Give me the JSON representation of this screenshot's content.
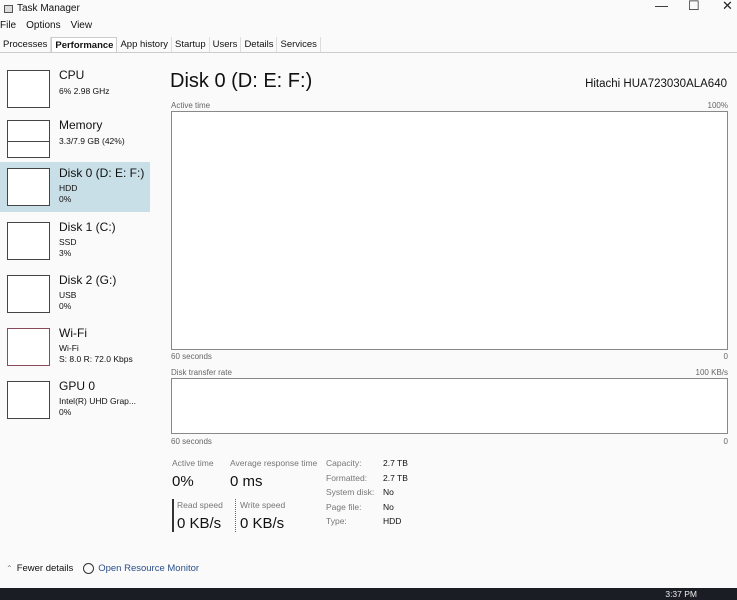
{
  "window": {
    "title": "Task Manager",
    "controls": [
      "—",
      "☐",
      "✕"
    ]
  },
  "menu": [
    "File",
    "Options",
    "View"
  ],
  "tabs": [
    {
      "label": "Processes"
    },
    {
      "label": "Performance",
      "selected": true
    },
    {
      "label": "App history"
    },
    {
      "label": "Startup"
    },
    {
      "label": "Users"
    },
    {
      "label": "Details"
    },
    {
      "label": "Services"
    }
  ],
  "sidebar": [
    {
      "name": "CPU",
      "l1": "6% 2.98 GHz",
      "l2": ""
    },
    {
      "name": "Memory",
      "l1": "3.3/7.9 GB (42%)",
      "l2": ""
    },
    {
      "name": "Disk 0 (D: E: F:)",
      "l1": "HDD",
      "l2": "0%",
      "selected": true
    },
    {
      "name": "Disk 1 (C:)",
      "l1": "SSD",
      "l2": "3%"
    },
    {
      "name": "Disk 2 (G:)",
      "l1": "USB",
      "l2": "0%"
    },
    {
      "name": "Wi-Fi",
      "l1": "Wi-Fi",
      "l2": "S: 8.0 R: 72.0 Kbps"
    },
    {
      "name": "GPU 0",
      "l1": "Intel(R) UHD Grap...",
      "l2": "0%"
    }
  ],
  "main": {
    "title": "Disk 0 (D: E: F:)",
    "model": "Hitachi HUA723030ALA640",
    "chart1": {
      "label": "Active time",
      "max": "100%",
      "xlabel": "60 seconds",
      "min": "0"
    },
    "chart2": {
      "label": "Disk transfer rate",
      "max": "100 KB/s",
      "xlabel": "60 seconds",
      "min": "0"
    },
    "stats": {
      "active_label": "Active time",
      "active": "0%",
      "resp_label": "Average response time",
      "resp": "0 ms",
      "read_label": "Read speed",
      "read": "0 KB/s",
      "write_label": "Write speed",
      "write": "0 KB/s"
    },
    "props": [
      [
        "Capacity:",
        "2.7 TB"
      ],
      [
        "Formatted:",
        "2.7 TB"
      ],
      [
        "System disk:",
        "No"
      ],
      [
        "Page file:",
        "No"
      ],
      [
        "Type:",
        "HDD"
      ]
    ]
  },
  "footer": {
    "fewer": "Fewer details",
    "resmon": "Open Resource Monitor"
  },
  "taskbar": {
    "clock": "3:37 PM"
  }
}
